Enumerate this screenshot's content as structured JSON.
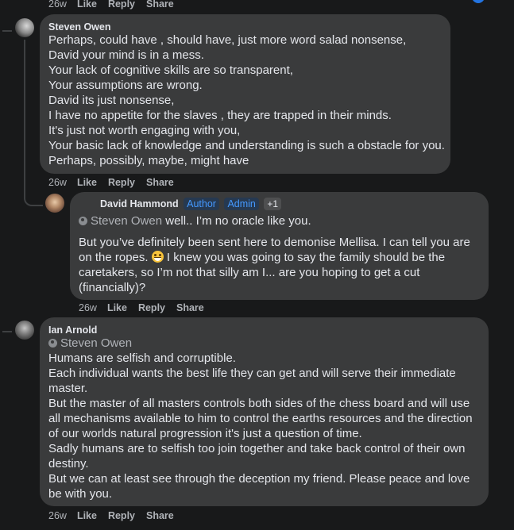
{
  "top_actions": {
    "time": "26w",
    "like": "Like",
    "reply": "Reply",
    "share": "Share"
  },
  "comments": [
    {
      "author": "Steven Owen",
      "lines": [
        "Perhaps, could have , should have, just more word salad nonsense,",
        "David your mind is in a mess.",
        "Your lack of cognitive skills are so transparent,",
        "Your assumptions are wrong.",
        "David its just nonsense,",
        "I have no appetite for the slaves , they are trapped in their minds.",
        "It's just not worth engaging with you,",
        "Your basic lack of knowledge and understanding is such a obstacle for you.",
        "Perhaps, possibly, maybe, might have"
      ],
      "actions": {
        "time": "26w",
        "like": "Like",
        "reply": "Reply",
        "share": "Share"
      }
    },
    {
      "author": "David Hammond",
      "badges": {
        "author": "Author",
        "admin": "Admin",
        "more": "+1"
      },
      "mention": "Steven Owen",
      "mention_text": " well.. I’m no oracle like you.",
      "lines": [
        "But you’ve definitely been sent here to demonise Mellisa. I can tell you are",
        "on the ropes.",
        " I knew you was going to say the family should be the",
        "caretakers, so I’m not that silly am I... are you hoping to get a cut",
        "(financially)?"
      ],
      "actions": {
        "time": "26w",
        "like": "Like",
        "reply": "Reply",
        "share": "Share"
      }
    },
    {
      "author": "Ian Arnold",
      "mention": "Steven Owen",
      "lines": [
        "Humans are selfish and corruptible.",
        "Each individual wants the best life they can get and will serve their immediate",
        "master.",
        "But the master of all masters controls both sides of the chess board and will use",
        "all mechanisms available to him to control the earths resources and the direction",
        "of our worlds natural progression it's just a question of time.",
        "Sadly humans are to selfish too join together and take back control of their own",
        "destiny.",
        "But we can at least see through the deception my friend. Please peace and love",
        "be with you."
      ],
      "actions": {
        "time": "26w",
        "like": "Like",
        "reply": "Reply",
        "share": "Share"
      }
    }
  ]
}
